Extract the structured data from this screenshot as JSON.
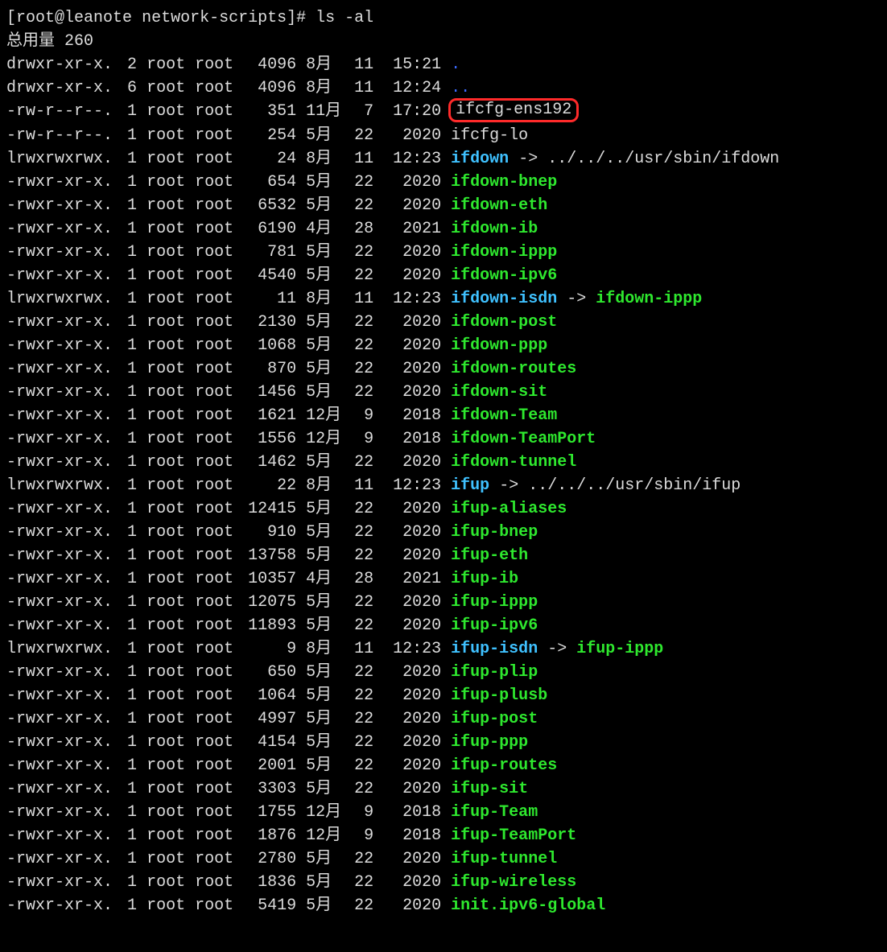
{
  "prompt": {
    "user": "root",
    "host": "leanote",
    "cwd": "network-scripts",
    "command": "ls -al"
  },
  "total_label": "总用量",
  "total_value": "260",
  "highlighted_file": "ifcfg-ens192",
  "rows": [
    {
      "perm": "drwxr-xr-x.",
      "links": "2",
      "owner": "root",
      "group": "root",
      "size": "4096",
      "month": "8月",
      "day": "11",
      "time": "15:21",
      "name": ".",
      "type": "dir"
    },
    {
      "perm": "drwxr-xr-x.",
      "links": "6",
      "owner": "root",
      "group": "root",
      "size": "4096",
      "month": "8月",
      "day": "11",
      "time": "12:24",
      "name": "..",
      "type": "dir"
    },
    {
      "perm": "-rw-r--r--.",
      "links": "1",
      "owner": "root",
      "group": "root",
      "size": "351",
      "month": "11月",
      "day": "7",
      "time": "17:20",
      "name": "ifcfg-ens192",
      "type": "file",
      "highlight": true
    },
    {
      "perm": "-rw-r--r--.",
      "links": "1",
      "owner": "root",
      "group": "root",
      "size": "254",
      "month": "5月",
      "day": "22",
      "time": "2020",
      "name": "ifcfg-lo",
      "type": "file"
    },
    {
      "perm": "lrwxrwxrwx.",
      "links": "1",
      "owner": "root",
      "group": "root",
      "size": "24",
      "month": "8月",
      "day": "11",
      "time": "12:23",
      "name": "ifdown",
      "type": "link",
      "target": "../../../usr/sbin/ifdown"
    },
    {
      "perm": "-rwxr-xr-x.",
      "links": "1",
      "owner": "root",
      "group": "root",
      "size": "654",
      "month": "5月",
      "day": "22",
      "time": "2020",
      "name": "ifdown-bnep",
      "type": "exec"
    },
    {
      "perm": "-rwxr-xr-x.",
      "links": "1",
      "owner": "root",
      "group": "root",
      "size": "6532",
      "month": "5月",
      "day": "22",
      "time": "2020",
      "name": "ifdown-eth",
      "type": "exec"
    },
    {
      "perm": "-rwxr-xr-x.",
      "links": "1",
      "owner": "root",
      "group": "root",
      "size": "6190",
      "month": "4月",
      "day": "28",
      "time": "2021",
      "name": "ifdown-ib",
      "type": "exec"
    },
    {
      "perm": "-rwxr-xr-x.",
      "links": "1",
      "owner": "root",
      "group": "root",
      "size": "781",
      "month": "5月",
      "day": "22",
      "time": "2020",
      "name": "ifdown-ippp",
      "type": "exec"
    },
    {
      "perm": "-rwxr-xr-x.",
      "links": "1",
      "owner": "root",
      "group": "root",
      "size": "4540",
      "month": "5月",
      "day": "22",
      "time": "2020",
      "name": "ifdown-ipv6",
      "type": "exec"
    },
    {
      "perm": "lrwxrwxrwx.",
      "links": "1",
      "owner": "root",
      "group": "root",
      "size": "11",
      "month": "8月",
      "day": "11",
      "time": "12:23",
      "name": "ifdown-isdn",
      "type": "link",
      "target": "ifdown-ippp",
      "target_type": "exec"
    },
    {
      "perm": "-rwxr-xr-x.",
      "links": "1",
      "owner": "root",
      "group": "root",
      "size": "2130",
      "month": "5月",
      "day": "22",
      "time": "2020",
      "name": "ifdown-post",
      "type": "exec"
    },
    {
      "perm": "-rwxr-xr-x.",
      "links": "1",
      "owner": "root",
      "group": "root",
      "size": "1068",
      "month": "5月",
      "day": "22",
      "time": "2020",
      "name": "ifdown-ppp",
      "type": "exec"
    },
    {
      "perm": "-rwxr-xr-x.",
      "links": "1",
      "owner": "root",
      "group": "root",
      "size": "870",
      "month": "5月",
      "day": "22",
      "time": "2020",
      "name": "ifdown-routes",
      "type": "exec"
    },
    {
      "perm": "-rwxr-xr-x.",
      "links": "1",
      "owner": "root",
      "group": "root",
      "size": "1456",
      "month": "5月",
      "day": "22",
      "time": "2020",
      "name": "ifdown-sit",
      "type": "exec"
    },
    {
      "perm": "-rwxr-xr-x.",
      "links": "1",
      "owner": "root",
      "group": "root",
      "size": "1621",
      "month": "12月",
      "day": "9",
      "time": "2018",
      "name": "ifdown-Team",
      "type": "exec"
    },
    {
      "perm": "-rwxr-xr-x.",
      "links": "1",
      "owner": "root",
      "group": "root",
      "size": "1556",
      "month": "12月",
      "day": "9",
      "time": "2018",
      "name": "ifdown-TeamPort",
      "type": "exec"
    },
    {
      "perm": "-rwxr-xr-x.",
      "links": "1",
      "owner": "root",
      "group": "root",
      "size": "1462",
      "month": "5月",
      "day": "22",
      "time": "2020",
      "name": "ifdown-tunnel",
      "type": "exec"
    },
    {
      "perm": "lrwxrwxrwx.",
      "links": "1",
      "owner": "root",
      "group": "root",
      "size": "22",
      "month": "8月",
      "day": "11",
      "time": "12:23",
      "name": "ifup",
      "type": "link",
      "target": "../../../usr/sbin/ifup"
    },
    {
      "perm": "-rwxr-xr-x.",
      "links": "1",
      "owner": "root",
      "group": "root",
      "size": "12415",
      "month": "5月",
      "day": "22",
      "time": "2020",
      "name": "ifup-aliases",
      "type": "exec"
    },
    {
      "perm": "-rwxr-xr-x.",
      "links": "1",
      "owner": "root",
      "group": "root",
      "size": "910",
      "month": "5月",
      "day": "22",
      "time": "2020",
      "name": "ifup-bnep",
      "type": "exec"
    },
    {
      "perm": "-rwxr-xr-x.",
      "links": "1",
      "owner": "root",
      "group": "root",
      "size": "13758",
      "month": "5月",
      "day": "22",
      "time": "2020",
      "name": "ifup-eth",
      "type": "exec"
    },
    {
      "perm": "-rwxr-xr-x.",
      "links": "1",
      "owner": "root",
      "group": "root",
      "size": "10357",
      "month": "4月",
      "day": "28",
      "time": "2021",
      "name": "ifup-ib",
      "type": "exec"
    },
    {
      "perm": "-rwxr-xr-x.",
      "links": "1",
      "owner": "root",
      "group": "root",
      "size": "12075",
      "month": "5月",
      "day": "22",
      "time": "2020",
      "name": "ifup-ippp",
      "type": "exec"
    },
    {
      "perm": "-rwxr-xr-x.",
      "links": "1",
      "owner": "root",
      "group": "root",
      "size": "11893",
      "month": "5月",
      "day": "22",
      "time": "2020",
      "name": "ifup-ipv6",
      "type": "exec"
    },
    {
      "perm": "lrwxrwxrwx.",
      "links": "1",
      "owner": "root",
      "group": "root",
      "size": "9",
      "month": "8月",
      "day": "11",
      "time": "12:23",
      "name": "ifup-isdn",
      "type": "link",
      "target": "ifup-ippp",
      "target_type": "exec"
    },
    {
      "perm": "-rwxr-xr-x.",
      "links": "1",
      "owner": "root",
      "group": "root",
      "size": "650",
      "month": "5月",
      "day": "22",
      "time": "2020",
      "name": "ifup-plip",
      "type": "exec"
    },
    {
      "perm": "-rwxr-xr-x.",
      "links": "1",
      "owner": "root",
      "group": "root",
      "size": "1064",
      "month": "5月",
      "day": "22",
      "time": "2020",
      "name": "ifup-plusb",
      "type": "exec"
    },
    {
      "perm": "-rwxr-xr-x.",
      "links": "1",
      "owner": "root",
      "group": "root",
      "size": "4997",
      "month": "5月",
      "day": "22",
      "time": "2020",
      "name": "ifup-post",
      "type": "exec"
    },
    {
      "perm": "-rwxr-xr-x.",
      "links": "1",
      "owner": "root",
      "group": "root",
      "size": "4154",
      "month": "5月",
      "day": "22",
      "time": "2020",
      "name": "ifup-ppp",
      "type": "exec"
    },
    {
      "perm": "-rwxr-xr-x.",
      "links": "1",
      "owner": "root",
      "group": "root",
      "size": "2001",
      "month": "5月",
      "day": "22",
      "time": "2020",
      "name": "ifup-routes",
      "type": "exec"
    },
    {
      "perm": "-rwxr-xr-x.",
      "links": "1",
      "owner": "root",
      "group": "root",
      "size": "3303",
      "month": "5月",
      "day": "22",
      "time": "2020",
      "name": "ifup-sit",
      "type": "exec"
    },
    {
      "perm": "-rwxr-xr-x.",
      "links": "1",
      "owner": "root",
      "group": "root",
      "size": "1755",
      "month": "12月",
      "day": "9",
      "time": "2018",
      "name": "ifup-Team",
      "type": "exec"
    },
    {
      "perm": "-rwxr-xr-x.",
      "links": "1",
      "owner": "root",
      "group": "root",
      "size": "1876",
      "month": "12月",
      "day": "9",
      "time": "2018",
      "name": "ifup-TeamPort",
      "type": "exec"
    },
    {
      "perm": "-rwxr-xr-x.",
      "links": "1",
      "owner": "root",
      "group": "root",
      "size": "2780",
      "month": "5月",
      "day": "22",
      "time": "2020",
      "name": "ifup-tunnel",
      "type": "exec"
    },
    {
      "perm": "-rwxr-xr-x.",
      "links": "1",
      "owner": "root",
      "group": "root",
      "size": "1836",
      "month": "5月",
      "day": "22",
      "time": "2020",
      "name": "ifup-wireless",
      "type": "exec"
    },
    {
      "perm": "-rwxr-xr-x.",
      "links": "1",
      "owner": "root",
      "group": "root",
      "size": "5419",
      "month": "5月",
      "day": "22",
      "time": "2020",
      "name": "init.ipv6-global",
      "type": "exec"
    }
  ]
}
